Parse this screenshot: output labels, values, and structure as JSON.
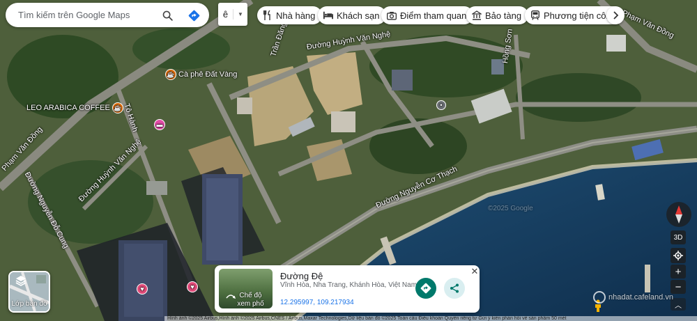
{
  "search": {
    "placeholder": "Tìm kiếm trên Google Maps"
  },
  "language": {
    "letter": "ê"
  },
  "chips": [
    {
      "icon": "fork-knife-icon",
      "label": "Nhà hàng"
    },
    {
      "icon": "bed-icon",
      "label": "Khách sạn"
    },
    {
      "icon": "camera-icon",
      "label": "Điểm tham quan"
    },
    {
      "icon": "museum-icon",
      "label": "Bảo tàng"
    },
    {
      "icon": "transit-icon",
      "label": "Phương tiện công"
    }
  ],
  "map": {
    "streets": [
      "Phạm Văn Đồng",
      "Đường Huỳnh Văn Nghệ",
      "Trần Đăng",
      "Hồng Sơn",
      "Phạm Văn Đồng",
      "Tô Hành",
      "Đường Huỳnh Văn Nghệ",
      "Đường Nguyễn Đỗ Cung",
      "Đường Nguyễn Cơ Thạch",
      "Phạm Văn Đồng"
    ],
    "pois": [
      {
        "label": "Cà phê Đất Vàng",
        "color": "#e8710a"
      },
      {
        "label": "LEO ARABICA COFFEE",
        "color": "#e8710a"
      }
    ],
    "watermark_imagery": "©2025 Google"
  },
  "layers": {
    "label": "Lớp bản đồ"
  },
  "card": {
    "thumb_label_1": "Chế độ",
    "thumb_label_2": "xem phố",
    "title": "Đường Đệ",
    "address": "Vĩnh Hòa, Nha Trang, Khánh Hòa, Việt Nam",
    "coords": "12.295997, 109.217934",
    "accent": "#00796b"
  },
  "controls": {
    "view_3d": "3D",
    "zoom_in": "+",
    "zoom_out": "−"
  },
  "watermark": {
    "text": "nhadat.cafeland.vn"
  },
  "attribution": {
    "text": "Hình ảnh ©2025 Airbus,Hình ảnh ©2025 Airbus,CNES / Airbus,Maxar Technologies,Dữ liệu bản đồ ©2025   Toàn cầu   Điều khoản   Quyền riêng tư   Gửi ý kiến phản hồi về sản phẩm   50 mét"
  }
}
